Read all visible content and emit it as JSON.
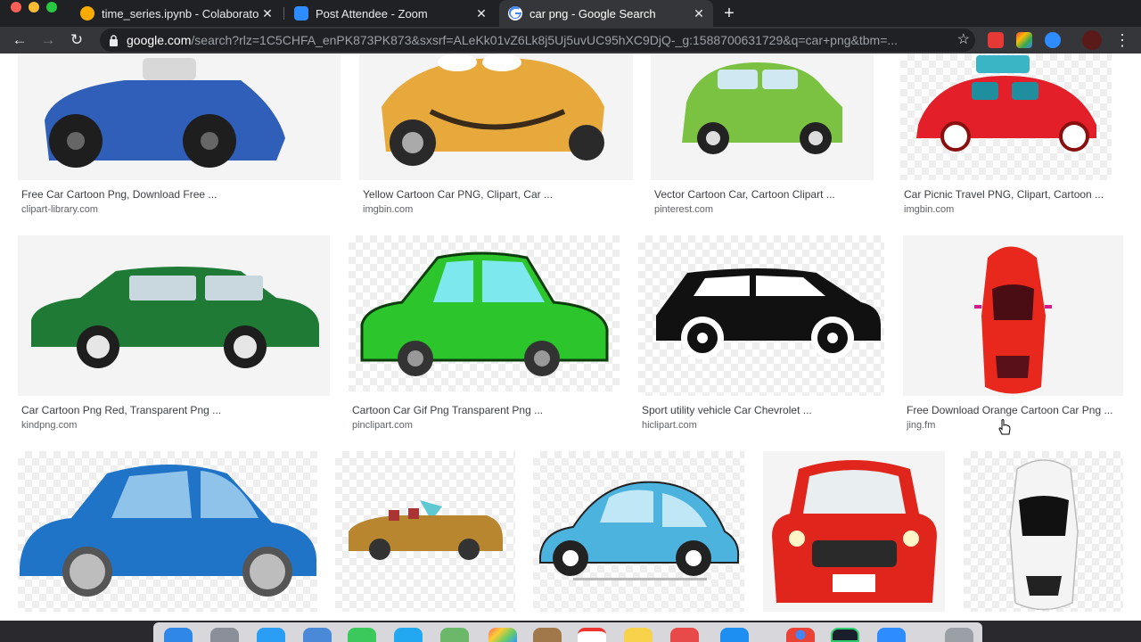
{
  "browser": {
    "tabs": [
      {
        "title": "time_series.ipynb - Colaboratory",
        "favicon": "colab-icon",
        "active": false
      },
      {
        "title": "Post Attendee - Zoom",
        "favicon": "zoom-icon",
        "active": false
      },
      {
        "title": "car png - Google Search",
        "favicon": "google-icon",
        "active": true
      }
    ],
    "close_glyph": "✕",
    "new_tab_glyph": "+",
    "url_host": "google.com",
    "url_rest": "/search?rlz=1C5CHFA_enPK873PK873&sxsrf=ALeKk01vZ6Lk8j5Uj5uvUC95hXC9DjQ-_g:1588700631729&q=car+png&tbm=...",
    "back_glyph": "←",
    "forward_glyph": "→",
    "reload_glyph": "↻",
    "bookmark_glyph": "☆",
    "menu_glyph": "⋮"
  },
  "results": {
    "row1": [
      {
        "title": "Free Car Cartoon Png, Download Free ...",
        "site": "clipart-library.com",
        "car_color": "#2f5fb8"
      },
      {
        "title": "Yellow Cartoon Car PNG, Clipart, Car ...",
        "site": "imgbin.com",
        "car_color": "#e8a93c"
      },
      {
        "title": "Vector Cartoon Car, Cartoon Clipart ...",
        "site": "pinterest.com",
        "car_color": "#7cc242"
      },
      {
        "title": "Car Picnic Travel PNG, Clipart, Cartoon ...",
        "site": "imgbin.com",
        "car_color": "#e3202a"
      }
    ],
    "row2": [
      {
        "title": "Car Cartoon Png Red, Transparent Png ...",
        "site": "kindpng.com",
        "car_color": "#1e7a35"
      },
      {
        "title": "Cartoon Car Gif Png Transparent Png ...",
        "site": "pinclipart.com",
        "car_color": "#2cc52c"
      },
      {
        "title": "Sport utility vehicle Car Chevrolet ...",
        "site": "hiclipart.com",
        "car_color": "#111111"
      },
      {
        "title": "Free Download Orange Cartoon Car Png ...",
        "site": "jing.fm",
        "car_color": "#e8281c"
      }
    ],
    "row3": [
      {
        "car_color": "#1f74c8"
      },
      {
        "car_color": "#b8862f"
      },
      {
        "car_color": "#4bb3dd"
      },
      {
        "car_color": "#e0261c"
      },
      {
        "car_color": "#f4f4f4"
      }
    ]
  },
  "colors": {
    "chrome_dark": "#202124",
    "chrome_mid": "#35363a",
    "link_title": "#3c4043",
    "site_text": "#5f6368"
  }
}
